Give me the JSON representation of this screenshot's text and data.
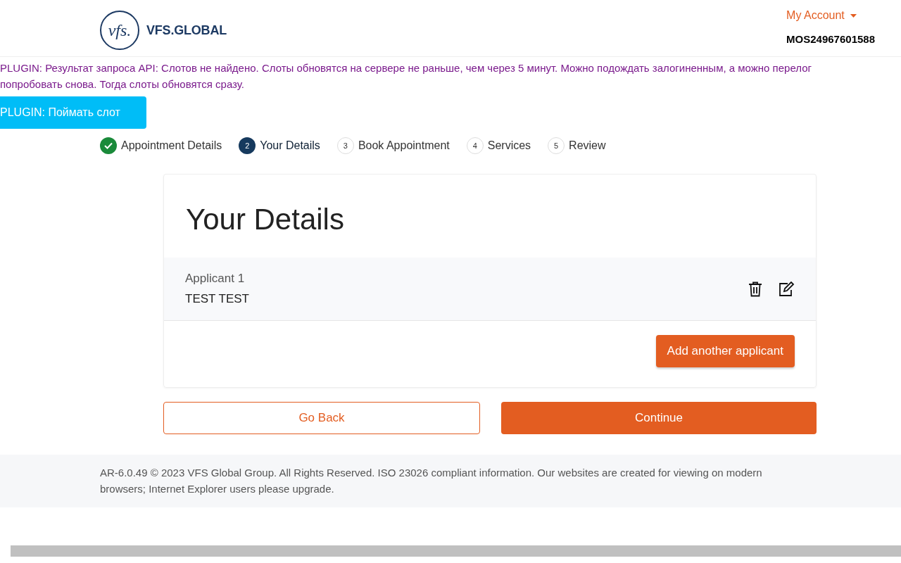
{
  "header": {
    "logo_mark": "vfs.",
    "logo_text": "VFS.GLOBAL",
    "account_menu": "My Account",
    "account_id": "MOS24967601588"
  },
  "plugin": {
    "message_lines": [
      "PLUGIN: Результат запроса API: Слотов не найдено. Слоты обновятся на сервере не раньше, чем через 5 минут. Можно подождать залогиненным, а можно перелог",
      "попробовать снова. Тогда слоты обновятся сразу."
    ],
    "button": "PLUGIN: Поймать слот"
  },
  "steps": [
    {
      "completed": true,
      "selected": false,
      "label": "Appointment Details"
    },
    {
      "completed": false,
      "selected": true,
      "number": "2",
      "label": "Your Details"
    },
    {
      "completed": false,
      "selected": false,
      "number": "3",
      "label": "Book Appointment"
    },
    {
      "completed": false,
      "selected": false,
      "number": "4",
      "label": "Services"
    },
    {
      "completed": false,
      "selected": false,
      "number": "5",
      "label": "Review"
    }
  ],
  "card": {
    "title": "Your Details",
    "applicants": [
      {
        "heading": "Applicant 1",
        "name": "TEST TEST"
      }
    ],
    "add_button": "Add another applicant"
  },
  "actions": {
    "back": "Go Back",
    "continue": "Continue"
  },
  "footer": "AR-6.0.49 © 2023 VFS Global Group. All Rights Reserved. ISO 23026 compliant information. Our websites are created for viewing on modern browsers; Internet Explorer users please upgrade."
}
